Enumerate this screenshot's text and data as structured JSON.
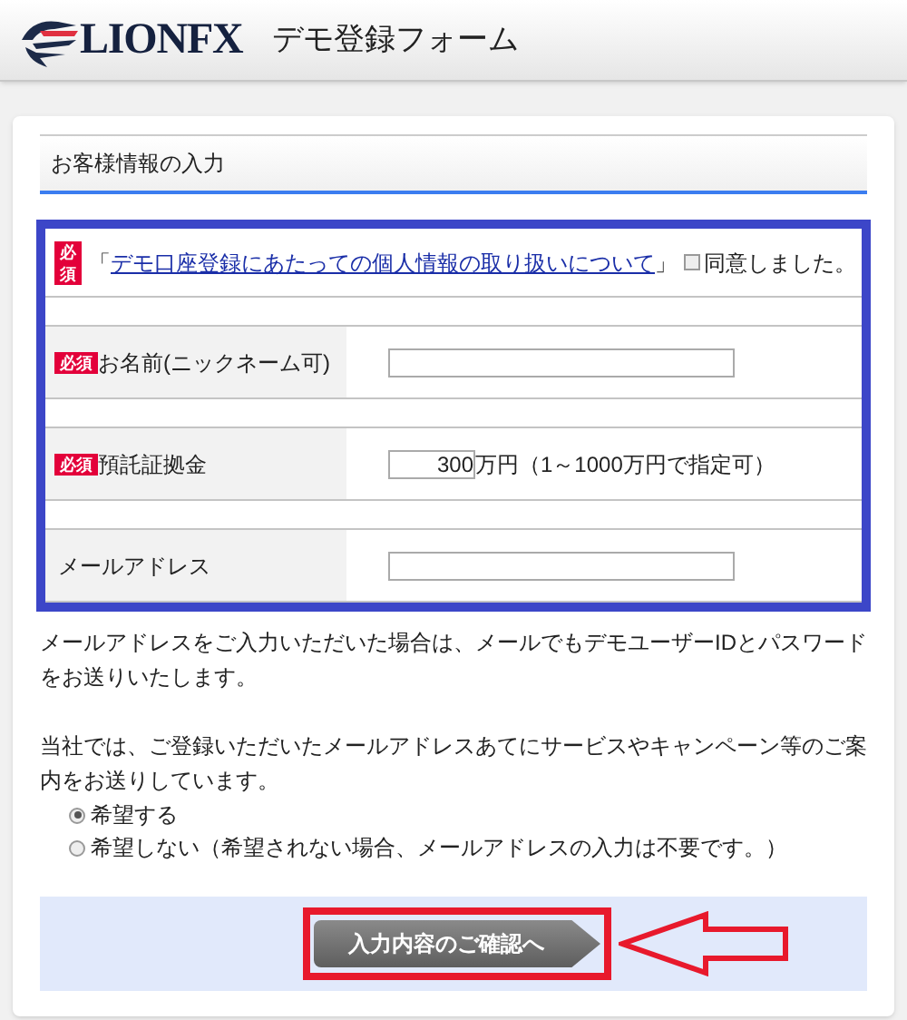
{
  "header": {
    "logo": "LIONFX",
    "title": "デモ登録フォーム"
  },
  "section_title": "お客様情報の入力",
  "consent": {
    "badge": "必須",
    "open": "「",
    "link": "デモ口座登録にあたっての個人情報の取り扱いについて",
    "close": "」",
    "checkbox_label": "同意しました。",
    "checked": false
  },
  "fields": [
    {
      "kind": "text",
      "label": "お名前(ニックネーム可)",
      "badge": "必須"
    },
    {
      "kind": "amount",
      "label": "預託証拠金",
      "badge": "必須",
      "value": "300",
      "suffix": "万円（1～1000万円で指定可）"
    },
    {
      "kind": "text",
      "label": "メールアドレス"
    }
  ],
  "notes": [
    "メールアドレスをご入力いただいた場合は、メールでもデモユーザーIDとパスワードをお送りいたします。",
    "当社では、ご登録いただいたメールアドレスあてにサービスやキャンペーン等のご案内をお送りしています。"
  ],
  "mail_options": [
    {
      "label": "希望する",
      "selected": true
    },
    {
      "label": "希望しない（希望されない場合、メールアドレスの入力は不要です。）",
      "selected": false
    }
  ],
  "submit": "入力内容のご確認へ"
}
